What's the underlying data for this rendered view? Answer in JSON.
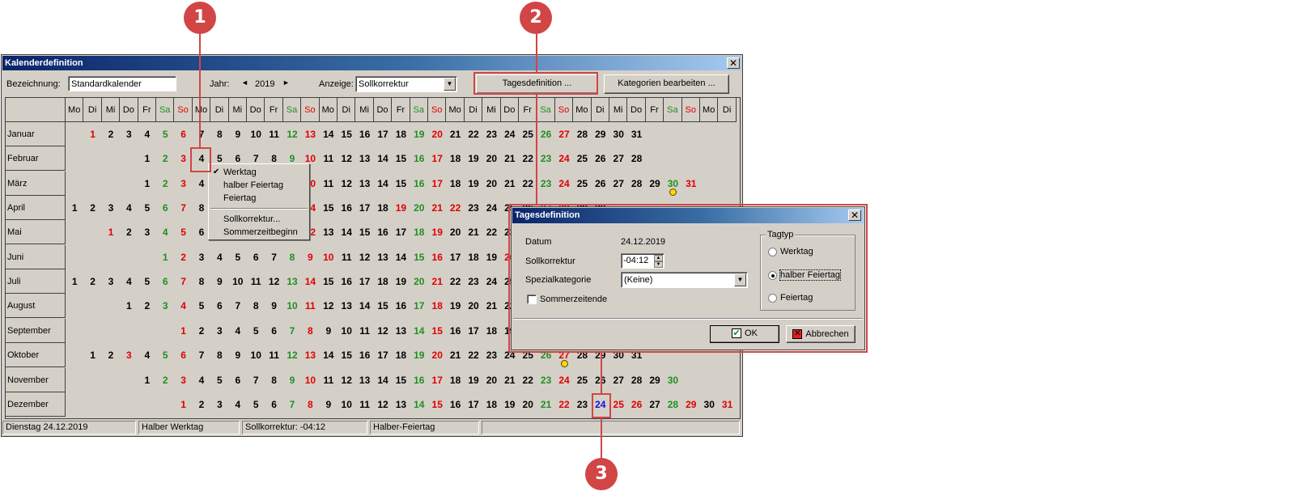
{
  "window": {
    "title": "Kalenderdefinition",
    "close": "✕"
  },
  "toolbar": {
    "bezeichnung_label": "Bezeichnung:",
    "bezeichnung_value": "Standardkalender",
    "jahr_label": "Jahr:",
    "jahr_prev": "◄",
    "jahr_value": "2019",
    "jahr_next": "►",
    "anzeige_label": "Anzeige:",
    "anzeige_value": "Sollkorrektur",
    "tagesdefinition_button": "Tagesdefinition ...",
    "kategorien_button": "Kategorien bearbeiten ..."
  },
  "calendar": {
    "weekday_headers": [
      "Mo",
      "Di",
      "Mi",
      "Do",
      "Fr",
      "Sa",
      "So",
      "Mo",
      "Di",
      "Mi",
      "Do",
      "Fr",
      "Sa",
      "So",
      "Mo",
      "Di",
      "Mi",
      "Do",
      "Fr",
      "Sa",
      "So",
      "Mo",
      "Di",
      "Mi",
      "Do",
      "Fr",
      "Sa",
      "So",
      "Mo",
      "Di",
      "Mi",
      "Do",
      "Fr",
      "Sa",
      "So",
      "Mo",
      "Di"
    ],
    "months": [
      {
        "name": "Januar",
        "start": 1,
        "days": 31
      },
      {
        "name": "Februar",
        "start": 4,
        "days": 28
      },
      {
        "name": "März",
        "start": 4,
        "days": 31
      },
      {
        "name": "April",
        "start": 0,
        "days": 30
      },
      {
        "name": "Mai",
        "start": 2,
        "days": 31
      },
      {
        "name": "Juni",
        "start": 5,
        "days": 30
      },
      {
        "name": "Juli",
        "start": 0,
        "days": 31
      },
      {
        "name": "August",
        "start": 3,
        "days": 31
      },
      {
        "name": "September",
        "start": 6,
        "days": 30
      },
      {
        "name": "Oktober",
        "start": 1,
        "days": 31
      },
      {
        "name": "November",
        "start": 4,
        "days": 30
      },
      {
        "name": "Dezember",
        "start": 6,
        "days": 31
      }
    ],
    "holidays_red": {
      "Januar": [
        1
      ],
      "März": [
        31
      ],
      "April": [
        19,
        21,
        22
      ],
      "Mai": [
        1,
        30
      ],
      "Juni": [
        9,
        10,
        20
      ],
      "Oktober": [
        3,
        27
      ],
      "Dezember": [
        25,
        26,
        24,
        31
      ]
    },
    "highlight": {
      "month": "Dezember",
      "day": 24
    }
  },
  "context_menu": {
    "items": [
      "Werktag",
      "halber Feiertag",
      "Feiertag",
      "Sollkorrektur...",
      "Sommerzeitbeginn"
    ],
    "checkmark": "✔"
  },
  "status_bar": {
    "date": "Dienstag 24.12.2019",
    "type": "Halber Werktag",
    "korrektur": "Sollkorrektur: -04:12",
    "category": "Halber-Feiertag",
    "extra": ""
  },
  "dialog": {
    "title": "Tagesdefinition",
    "close": "✕",
    "datum_label": "Datum",
    "datum_value": "24.12.2019",
    "sollkorrektur_label": "Sollkorrektur",
    "sollkorrektur_value": "-04:12",
    "spezialkategorie_label": "Spezialkategorie",
    "spezialkategorie_value": "(Keine)",
    "sommerzeitende_label": "Sommerzeitende",
    "tagtyp_label": "Tagtyp",
    "tagtyp_options": [
      "Werktag",
      "halber Feiertag",
      "Feiertag"
    ],
    "tagtyp_selected": "halber Feiertag",
    "ok_label": "OK",
    "abbrechen_label": "Abbrechen"
  },
  "annotations": {
    "c1": "1",
    "c2": "2",
    "c3": "3"
  },
  "colors": {
    "saturday": "#1f8f1f",
    "sunday_holiday": "#e00000",
    "highlight": "#1010e0",
    "annotation": "#d24545"
  }
}
